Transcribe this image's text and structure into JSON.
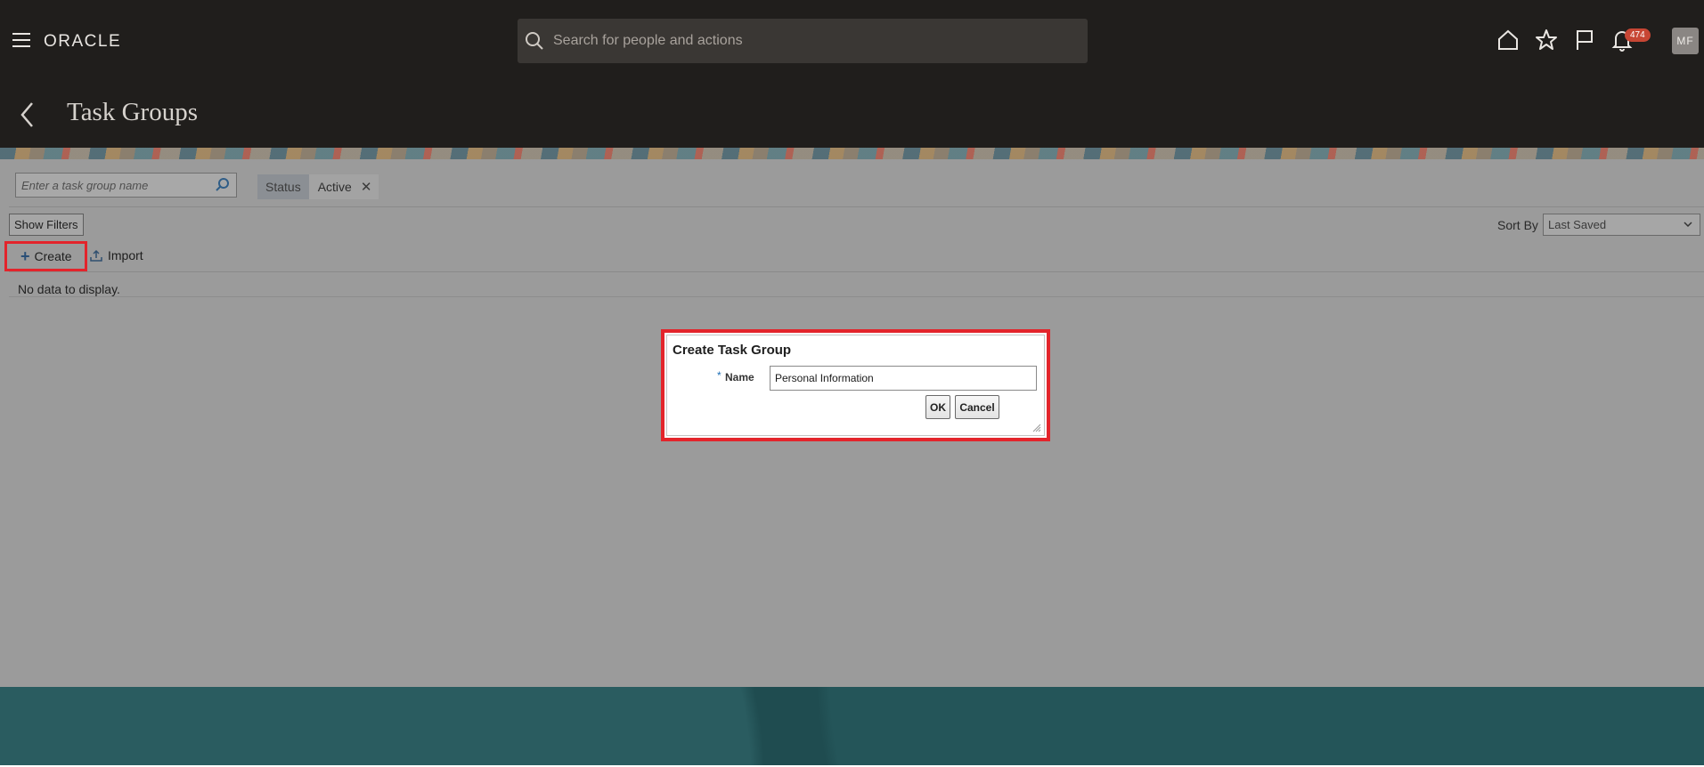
{
  "header": {
    "logo": "ORACLE",
    "search_placeholder": "Search for people and actions",
    "notification_count": "474",
    "avatar_initials": "MF",
    "icons": [
      "hamburger-icon",
      "home-icon",
      "star-icon",
      "flag-icon",
      "bell-icon"
    ]
  },
  "page": {
    "title": "Task Groups"
  },
  "toolbar": {
    "search_placeholder": "Enter a task group name",
    "status_chip_label": "Status",
    "status_chip_value": "Active",
    "show_filters_label": "Show Filters",
    "sort_by_label": "Sort By",
    "sort_by_value": "Last Saved",
    "create_label": "Create",
    "import_label": "Import"
  },
  "results": {
    "empty_message": "No data to display."
  },
  "dialog": {
    "title": "Create Task Group",
    "required_marker": "*",
    "name_label": "Name",
    "name_value": "Personal Information",
    "ok_label": "OK",
    "cancel_label": "Cancel"
  },
  "colors": {
    "header_bg": "#201e1c",
    "overlay_gray": "#9b9b9b",
    "highlight_red": "#e3242b",
    "footer_teal": "#1f4c50",
    "badge_red": "#c74634"
  }
}
